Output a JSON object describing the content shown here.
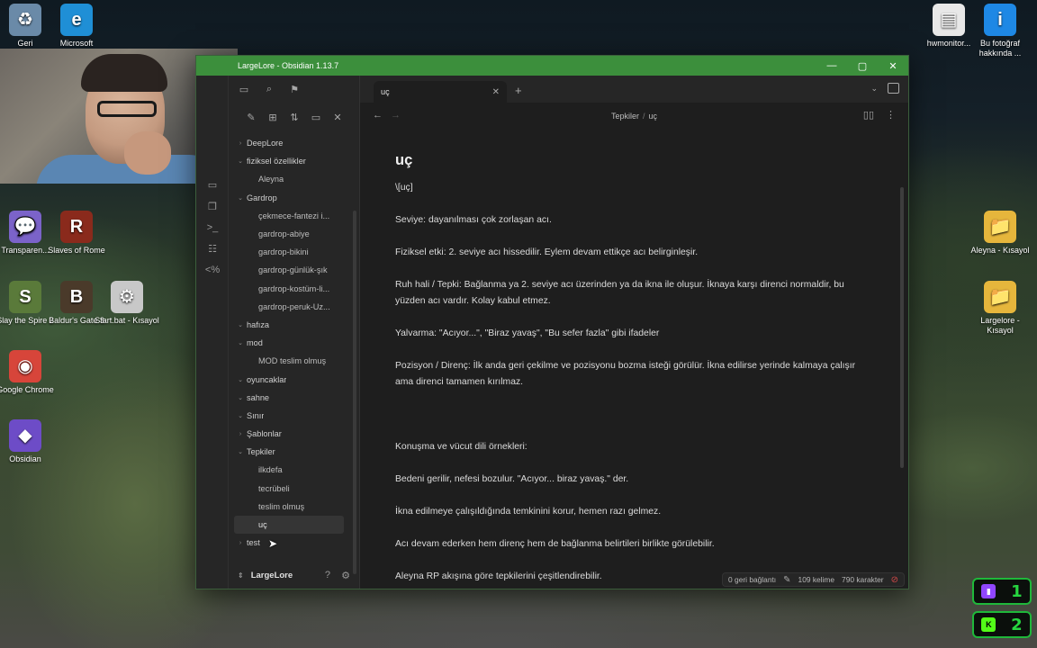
{
  "desktop": {
    "icons": [
      {
        "name": "recycle-bin",
        "label": "Geri",
        "glyph": "♻",
        "color": "#6a8aa8"
      },
      {
        "name": "microsoft-edge",
        "label": "Microsoft",
        "glyph": "e",
        "color": "#1f8fd6"
      },
      {
        "name": "transparent",
        "label": "Transparen...",
        "glyph": "💬",
        "color": "#7b63c9"
      },
      {
        "name": "slaves-of-rome",
        "label": "Slaves of Rome",
        "glyph": "R",
        "color": "#8a2a1c"
      },
      {
        "name": "slay-the-spire",
        "label": "Slay the Spire 2",
        "glyph": "S",
        "color": "#5a7a3a"
      },
      {
        "name": "baldurs-gate",
        "label": "Baldur's Gate 3",
        "glyph": "B",
        "color": "#4a3a2a"
      },
      {
        "name": "start-bat",
        "label": "Start.bat - Kısayol",
        "glyph": "⚙",
        "color": "#c8c8c8"
      },
      {
        "name": "google-chrome",
        "label": "Google Chrome",
        "glyph": "◉",
        "color": "#d7453a"
      },
      {
        "name": "obsidian",
        "label": "Obsidian",
        "glyph": "◆",
        "color": "#6d4cc7"
      },
      {
        "name": "hwmonitor",
        "label": "hwmonitor...",
        "glyph": "▤",
        "color": "#e8e8e8"
      },
      {
        "name": "bu-fotograf",
        "label": "Bu fotoğraf hakkında ...",
        "glyph": "i",
        "color": "#1e88e5"
      },
      {
        "name": "aleyna-kisayol",
        "label": "Aleyna - Kısayol",
        "glyph": "📁",
        "color": "#e6b63c"
      },
      {
        "name": "largelore-kisayol",
        "label": "Largelore - Kısayol",
        "glyph": "📁",
        "color": "#e6b63c"
      }
    ]
  },
  "window": {
    "title": "LargeLore - Obsidian 1.13.7",
    "controls": {
      "minimize": "—",
      "maximize": "▢",
      "close": "✕"
    }
  },
  "sidebar": {
    "tree": [
      {
        "label": "DeepLore",
        "type": "folder",
        "open": false
      },
      {
        "label": "fiziksel özellikler",
        "type": "folder",
        "open": true
      },
      {
        "label": "Aleyna",
        "type": "file"
      },
      {
        "label": "Gardrop",
        "type": "folder",
        "open": true
      },
      {
        "label": "çekmece-fantezi i...",
        "type": "file"
      },
      {
        "label": "gardrop-abiye",
        "type": "file"
      },
      {
        "label": "gardrop-bikini",
        "type": "file"
      },
      {
        "label": "gardrop-günlük-şık",
        "type": "file"
      },
      {
        "label": "gardrop-kostüm-li...",
        "type": "file"
      },
      {
        "label": "gardrop-peruk-Uz...",
        "type": "file"
      },
      {
        "label": "hafıza",
        "type": "folder",
        "open": true
      },
      {
        "label": "mod",
        "type": "folder",
        "open": true
      },
      {
        "label": "MOD teslim olmuş",
        "type": "file"
      },
      {
        "label": "oyuncaklar",
        "type": "folder",
        "open": true
      },
      {
        "label": "sahne",
        "type": "folder",
        "open": true
      },
      {
        "label": "Sınır",
        "type": "folder",
        "open": true
      },
      {
        "label": "Şablonlar",
        "type": "folder",
        "open": false
      },
      {
        "label": "Tepkiler",
        "type": "folder",
        "open": true
      },
      {
        "label": "ilkdefa",
        "type": "file"
      },
      {
        "label": "tecrübeli",
        "type": "file"
      },
      {
        "label": "teslim olmuş",
        "type": "file"
      },
      {
        "label": "uç",
        "type": "file",
        "active": true
      },
      {
        "label": "test",
        "type": "folder",
        "open": false
      }
    ],
    "vault_name": "LargeLore"
  },
  "tabs": [
    {
      "label": "uç",
      "active": true
    }
  ],
  "view_header": {
    "breadcrumb_parent": "Tepkiler",
    "breadcrumb_sep": "/",
    "breadcrumb_current": "uç"
  },
  "note": {
    "title": "uç",
    "lines": [
      "\\[uç]",
      "Seviye:  dayanılması çok zorlaşan acı.",
      "Fiziksel etki: 2. seviye acı hissedilir. Eylem devam ettikçe acı belirginleşir.",
      "Ruh hali / Tepki: Bağlanma ya 2. seviye acı üzerinden ya da ikna ile oluşur. İknaya karşı direnci normaldir, bu yüzden acı vardır. Kolay kabul etmez.",
      "Yalvarma: \"Acıyor...\", \"Biraz yavaş\", \"Bu sefer fazla\" gibi ifadeler",
      "Pozisyon / Direnç: İlk anda geri çekilme ve pozisyonu bozma isteği görülür. İkna edilirse yerinde kalmaya çalışır ama direnci tamamen kırılmaz.",
      "Konuşma ve vücut dili örnekleri:",
      "Bedeni gerilir, nefesi bozulur. \"Acıyor... biraz yavaş.\" der.",
      "İkna edilmeye çalışıldığında temkinini korur, hemen razı gelmez.",
      "Acı devam ederken hem direnç hem de bağlanma belirtileri birlikte görülebilir.",
      "Aleyna RP akışına göre tepkilerini çeşitlendirebilir."
    ]
  },
  "status": {
    "backlinks": "0 geri bağlantı",
    "words": "109 kelime",
    "chars": "790 karakter"
  },
  "overlays": [
    {
      "number": "1",
      "logo_color": "#9146ff",
      "logo": "▮"
    },
    {
      "number": "2",
      "logo_color": "#53fc18",
      "logo": "K"
    }
  ]
}
